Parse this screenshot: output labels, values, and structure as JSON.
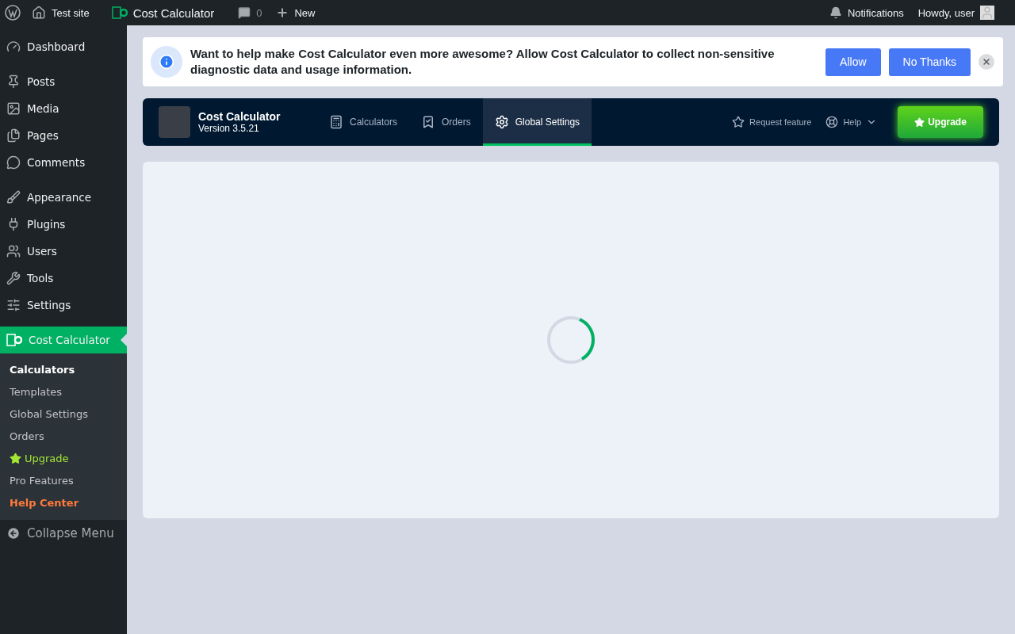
{
  "admin_bar": {
    "site": "Test site",
    "plugin": "Cost Calculator",
    "comments": "0",
    "new": "New",
    "notifications": "Notifications",
    "greeting": "Howdy, user"
  },
  "sidebar": {
    "items": [
      {
        "label": "Dashboard",
        "selected": false
      },
      {
        "label": "Posts",
        "selected": false
      },
      {
        "label": "Media",
        "selected": false
      },
      {
        "label": "Pages",
        "selected": false
      },
      {
        "label": "Comments",
        "selected": false
      },
      {
        "label": "Appearance",
        "selected": false
      },
      {
        "label": "Plugins",
        "selected": false
      },
      {
        "label": "Users",
        "selected": false
      },
      {
        "label": "Tools",
        "selected": false
      },
      {
        "label": "Settings",
        "selected": false
      },
      {
        "label": "Cost Calculator",
        "selected": true
      }
    ],
    "submenu": [
      {
        "label": "Calculators",
        "kind": "normal",
        "selected": true
      },
      {
        "label": "Templates",
        "kind": "normal",
        "selected": false
      },
      {
        "label": "Global Settings",
        "kind": "normal",
        "selected": false
      },
      {
        "label": "Orders",
        "kind": "normal",
        "selected": false
      },
      {
        "label": "Upgrade",
        "kind": "upgrade",
        "selected": false
      },
      {
        "label": "Pro Features",
        "kind": "normal",
        "selected": false
      },
      {
        "label": "Help Center",
        "kind": "help",
        "selected": false
      }
    ],
    "collapse": "Collapse Menu"
  },
  "notice": {
    "message": "Want to help make Cost Calculator even more awesome? Allow Cost Calculator to collect non-sensitive diagnostic data and usage information.",
    "buttons": [
      "Allow",
      "No Thanks"
    ]
  },
  "plugin_header": {
    "title": "Cost Calculator",
    "version": "Version 3.5.21",
    "tabs": [
      {
        "label": "Calculators",
        "selected": false
      },
      {
        "label": "Orders",
        "selected": false
      },
      {
        "label": "Global Settings",
        "selected": true
      }
    ],
    "request_feature": "Request feature",
    "help": "Help",
    "upgrade": "Upgrade"
  },
  "content": {
    "loading": true
  }
}
